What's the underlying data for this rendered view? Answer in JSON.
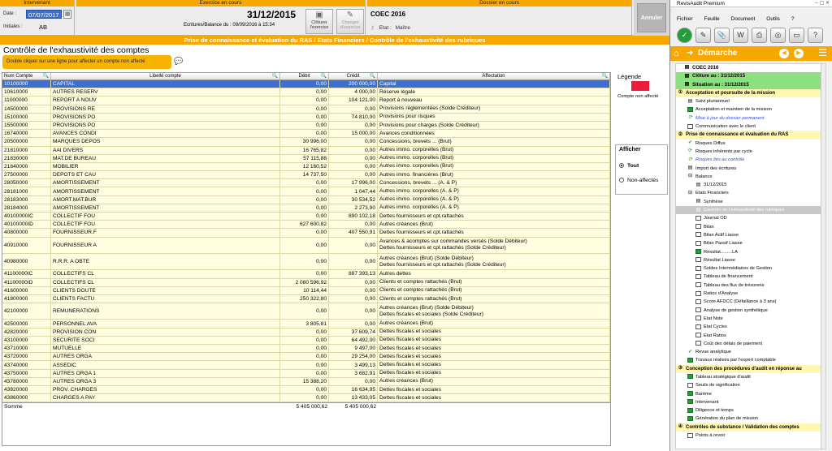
{
  "header": {
    "intervenant": {
      "title": "Intervenant",
      "date_label": "Date :",
      "date_value": "07/07/2017",
      "initials_label": "Initiales :",
      "initials_value": "AB"
    },
    "exercice": {
      "title": "Exercice en cours",
      "date": "31/12/2015",
      "ecritures": "Ecritures/Balance du :  09/09/2016 à 15:34",
      "cloturer": "Clôturer l'exercice",
      "changer": "Changer d'exercice"
    },
    "dossier": {
      "title": "Dossier en cours",
      "name": "COEC 2016",
      "etat_label": "Etat :",
      "etat_value": "Maître"
    },
    "annuler": "Annuler"
  },
  "title_bar": "Prise de connaissance et évaluation du RAS / Etats Financiers / Contrôle de l'exhaustivité des rubriques",
  "page_title": "Contrôle de l'exhaustivité des comptes",
  "hint": "Double cliquer sur une ligne pour affecter un compte non affecté",
  "table": {
    "headers": {
      "num": "Num Compte",
      "libelle": "Libellé compte",
      "debit": "Débit",
      "credit": "Crédit",
      "affectation": "Affectation"
    },
    "rows": [
      {
        "num": "10100000",
        "lib": "CAPITAL",
        "deb": "0,00",
        "cre": "200 000,00",
        "aff": [
          "Capital"
        ]
      },
      {
        "num": "10610000",
        "lib": "AUTRES RESERV",
        "deb": "0,00",
        "cre": "4 000,00",
        "aff": [
          "Réserve légale"
        ]
      },
      {
        "num": "11000000",
        "lib": "REPORT A NOUV",
        "deb": "0,00",
        "cre": "104 121,00",
        "aff": [
          "Report à nouveau"
        ]
      },
      {
        "num": "14500000",
        "lib": "PROVISIONS RE",
        "deb": "0,00",
        "cre": "0,00",
        "aff": [
          "Provisions réglementées  (Solde Créditeur)"
        ]
      },
      {
        "num": "15100000",
        "lib": "PROVISIONS PO",
        "deb": "0,00",
        "cre": "74 810,00",
        "aff": [
          "Provisions pour risques"
        ]
      },
      {
        "num": "15500000",
        "lib": "PROVISIONS PO",
        "deb": "0,00",
        "cre": "0,00",
        "aff": [
          "Provisions pour charges  (Solde Créditeur)"
        ]
      },
      {
        "num": "16740000",
        "lib": "AVANCES CONDI",
        "deb": "0,00",
        "cre": "15 000,00",
        "aff": [
          "Avances conditionnées"
        ]
      },
      {
        "num": "20500000",
        "lib": "MARQUES DEPOS",
        "deb": "30 996,00",
        "cre": "0,00",
        "aff": [
          "Concessions, brevets ...  (Brut)"
        ]
      },
      {
        "num": "21810000",
        "lib": "AAI DIVERS",
        "deb": "16 765,82",
        "cre": "0,00",
        "aff": [
          "Autres immo. corporelles  (Brut)"
        ]
      },
      {
        "num": "21830000",
        "lib": "MAT.DE BUREAU",
        "deb": "57 115,88",
        "cre": "0,00",
        "aff": [
          "Autres immo. corporelles  (Brut)"
        ]
      },
      {
        "num": "21840000",
        "lib": "MOBILIER",
        "deb": "12 160,52",
        "cre": "0,00",
        "aff": [
          "Autres immo. corporelles  (Brut)"
        ]
      },
      {
        "num": "27500000",
        "lib": "DEPOTS ET CAU",
        "deb": "14 737,50",
        "cre": "0,00",
        "aff": [
          "Autres immo. financières  (Brut)"
        ]
      },
      {
        "num": "28050000",
        "lib": "AMORTISSEMENT",
        "deb": "0,00",
        "cre": "17 996,00",
        "aff": [
          "Concessions, brevets ...  (A. & P)"
        ]
      },
      {
        "num": "28181000",
        "lib": "AMORTISSEMENT",
        "deb": "0,00",
        "cre": "1 047,44",
        "aff": [
          "Autres immo. corporelles  (A. & P)"
        ]
      },
      {
        "num": "28183000",
        "lib": "AMORT.MAT.BUR",
        "deb": "0,00",
        "cre": "30 534,52",
        "aff": [
          "Autres immo. corporelles  (A. & P)"
        ]
      },
      {
        "num": "28184000",
        "lib": "AMORTISSEMENT",
        "deb": "0,00",
        "cre": "2 273,90",
        "aff": [
          "Autres immo. corporelles  (A. & P)"
        ]
      },
      {
        "num": "40100000IC",
        "lib": "COLLECTIF FOU",
        "deb": "0,00",
        "cre": "890 102,18",
        "aff": [
          "Dettes fournisseurs et cpt.rattachés"
        ]
      },
      {
        "num": "40100000ID",
        "lib": "COLLECTIF FOU",
        "deb": "627 600,82",
        "cre": "0,00",
        "aff": [
          "Autres créances  (Brut)"
        ]
      },
      {
        "num": "40800000",
        "lib": "FOURNISSEUR.F",
        "deb": "0,00",
        "cre": "407 550,91",
        "aff": [
          "Dettes fournisseurs et cpt.rattachés"
        ]
      },
      {
        "num": "40910000",
        "lib": "FOURNISSEUR A",
        "deb": "0,00",
        "cre": "0,00",
        "aff": [
          "Avances & acomptes sur commandes versés  (Solde Débiteur)",
          "Dettes fournisseurs et cpt.rattachés  (Solde Créditeur)"
        ]
      },
      {
        "num": "40980000",
        "lib": "R.R.R. A OBTE",
        "deb": "0,00",
        "cre": "0,00",
        "aff": [
          "Autres créances (Brut)  (Solde Débiteur)",
          "Dettes fournisseurs et cpt.rattachés  (Solde Créditeur)"
        ]
      },
      {
        "num": "41100000IC",
        "lib": "COLLECTIFS CL",
        "deb": "0,00",
        "cre": "887 393,13",
        "aff": [
          "Autres dettes"
        ]
      },
      {
        "num": "41100000ID",
        "lib": "COLLECTIFS CL",
        "deb": "2 080 596,92",
        "cre": "0,00",
        "aff": [
          "Clients et comptes rattachés  (Brut)"
        ]
      },
      {
        "num": "41600000",
        "lib": "CLIENTS DOUTE",
        "deb": "10 114,44",
        "cre": "0,00",
        "aff": [
          "Clients et comptes rattachés  (Brut)"
        ]
      },
      {
        "num": "41800000",
        "lib": "CLIENTS FACTU",
        "deb": "250 322,80",
        "cre": "0,00",
        "aff": [
          "Clients et comptes rattachés  (Brut)"
        ]
      },
      {
        "num": "42100000",
        "lib": "REMUNERATIONS",
        "deb": "0,00",
        "cre": "0,00",
        "aff": [
          "Autres créances (Brut)  (Solde Débiteur)",
          "Dettes fiscales et sociales  (Solde Créditeur)"
        ]
      },
      {
        "num": "42500000",
        "lib": "PERSONNEL AVA",
        "deb": "3 805,81",
        "cre": "0,00",
        "aff": [
          "Autres créances  (Brut)"
        ]
      },
      {
        "num": "42820000",
        "lib": "PROVISION CON",
        "deb": "0,00",
        "cre": "37 609,74",
        "aff": [
          "Dettes fiscales et sociales"
        ]
      },
      {
        "num": "43100000",
        "lib": "SECURITE SOCI",
        "deb": "0,00",
        "cre": "64 492,00",
        "aff": [
          "Dettes fiscales et sociales"
        ]
      },
      {
        "num": "43710000",
        "lib": "MUTUELLE",
        "deb": "0,00",
        "cre": "9 497,00",
        "aff": [
          "Dettes fiscales et sociales"
        ]
      },
      {
        "num": "43720000",
        "lib": "AUTRES ORGA",
        "deb": "0,00",
        "cre": "29 254,00",
        "aff": [
          "Dettes fiscales et sociales"
        ]
      },
      {
        "num": "43740000",
        "lib": "ASSEDIC",
        "deb": "0,00",
        "cre": "3 499,13",
        "aff": [
          "Dettes fiscales et sociales"
        ]
      },
      {
        "num": "43750000",
        "lib": "AUTRES ORGA 1",
        "deb": "0,00",
        "cre": "3 682,91",
        "aff": [
          "Dettes fiscales et sociales"
        ]
      },
      {
        "num": "43780000",
        "lib": "AUTRES ORGA 3",
        "deb": "15 388,20",
        "cre": "0,00",
        "aff": [
          "Autres créances  (Brut)"
        ]
      },
      {
        "num": "43820000",
        "lib": "PROV. CHARGES",
        "deb": "0,00",
        "cre": "16 634,95",
        "aff": [
          "Dettes fiscales et sociales"
        ]
      },
      {
        "num": "43860000",
        "lib": "CHARGES A PAY",
        "deb": "0,00",
        "cre": "13 433,05",
        "aff": [
          "Dettes fiscales et sociales"
        ]
      }
    ],
    "total": {
      "label": "Somme",
      "deb": "5 405 000,62",
      "cre": "5 405 000,62"
    }
  },
  "legend": {
    "title": "Légende",
    "swatch_color": "#ea1b3d",
    "text": "Compte non affecté"
  },
  "filter": {
    "title": "Afficher",
    "opt_all": "Tout",
    "opt_unassigned": "Non-affectés"
  },
  "panel": {
    "app_title": "RevisAudit Premium",
    "menu": [
      "Fichier",
      "Feuille",
      "Document",
      "Outils",
      "?"
    ],
    "nav_title": "Démarche",
    "tree": [
      {
        "t": "COEC 2016",
        "k": "bold",
        "ind": 10,
        "ic": "doc"
      },
      {
        "t": "Clôture au   : 31/12/2015",
        "k": "ok",
        "ind": 10,
        "ic": "doc"
      },
      {
        "t": "Situation au  : 31/12/2015",
        "k": "ok",
        "ind": 10,
        "ic": "doc"
      },
      {
        "t": "Acceptation et poursuite de la mission",
        "k": "sec",
        "ind": 2,
        "ic": "num1"
      },
      {
        "t": "Suivi pluriannuel",
        "k": "",
        "ind": 14,
        "ic": "doc"
      },
      {
        "t": "Acceptation et maintien de la mission",
        "k": "",
        "ind": 14,
        "ic": "fill"
      },
      {
        "t": "Mise à jour du dossier permanent",
        "k": "link",
        "ind": 14,
        "ic": "spin"
      },
      {
        "t": "Communication avec le client",
        "k": "",
        "ind": 14,
        "ic": "box"
      },
      {
        "t": "Prise de connaissance et évaluation du RAS",
        "k": "sec",
        "ind": 2,
        "ic": "num2"
      },
      {
        "t": "Risques Diffus",
        "k": "",
        "ind": 14,
        "ic": "ok"
      },
      {
        "t": "Risques inhérents par cycle",
        "k": "",
        "ind": 14,
        "ic": "spin"
      },
      {
        "t": "Risques liés au contrôle",
        "k": "link",
        "ind": 14,
        "ic": "spin"
      },
      {
        "t": "Import des écritures",
        "k": "",
        "ind": 14,
        "ic": "doc"
      },
      {
        "t": "Balance",
        "k": "",
        "ind": 14,
        "ic": "minus"
      },
      {
        "t": "31/12/2015",
        "k": "",
        "ind": 24,
        "ic": "doc"
      },
      {
        "t": "Etats Financiers",
        "k": "",
        "ind": 14,
        "ic": "minus"
      },
      {
        "t": "Synthèse",
        "k": "",
        "ind": 24,
        "ic": "doc"
      },
      {
        "t": "Contrôle de l'exhaustivité des rubriques",
        "k": "cur",
        "ind": 24,
        "ic": "doc"
      },
      {
        "t": "Journal OD",
        "k": "",
        "ind": 24,
        "ic": "box"
      },
      {
        "t": "Bilan",
        "k": "",
        "ind": 24,
        "ic": "box"
      },
      {
        "t": "Bilan Actif Liasse",
        "k": "",
        "ind": 24,
        "ic": "box"
      },
      {
        "t": "Bilan Passif Liasse",
        "k": "",
        "ind": 24,
        "ic": "box"
      },
      {
        "t": "Résultat.........LA",
        "k": "",
        "ind": 24,
        "ic": "fill"
      },
      {
        "t": "Résultat Liasse",
        "k": "",
        "ind": 24,
        "ic": "box"
      },
      {
        "t": "Soldes Intermédiaires de Gestion",
        "k": "",
        "ind": 24,
        "ic": "box"
      },
      {
        "t": "Tableau de financement",
        "k": "",
        "ind": 24,
        "ic": "box"
      },
      {
        "t": "Tableau des flux de trésorerie",
        "k": "",
        "ind": 24,
        "ic": "box"
      },
      {
        "t": "Ratios d'Analyse",
        "k": "",
        "ind": 24,
        "ic": "box"
      },
      {
        "t": "Score AFDCC (Défaillance à 3 ans)",
        "k": "",
        "ind": 24,
        "ic": "box"
      },
      {
        "t": "Analyse de gestion synthétique",
        "k": "",
        "ind": 24,
        "ic": "box"
      },
      {
        "t": "Etat Note",
        "k": "",
        "ind": 24,
        "ic": "box"
      },
      {
        "t": "Etat Cycles",
        "k": "",
        "ind": 24,
        "ic": "box"
      },
      {
        "t": "Etat Ratios",
        "k": "",
        "ind": 24,
        "ic": "box"
      },
      {
        "t": "Coût des délais de paiement",
        "k": "",
        "ind": 24,
        "ic": "box"
      },
      {
        "t": "Revue analytique",
        "k": "",
        "ind": 14,
        "ic": "ok"
      },
      {
        "t": "Travaux réalisés par l'expert comptable",
        "k": "",
        "ind": 14,
        "ic": "fill"
      },
      {
        "t": "Conception des procédures d'audit en réponse au",
        "k": "sec",
        "ind": 2,
        "ic": "num3"
      },
      {
        "t": "Tableau stratégique d'audit",
        "k": "",
        "ind": 14,
        "ic": "fill"
      },
      {
        "t": "Seuils de signification",
        "k": "",
        "ind": 14,
        "ic": "box"
      },
      {
        "t": "Barème",
        "k": "",
        "ind": 14,
        "ic": "fill"
      },
      {
        "t": "Intervenant",
        "k": "",
        "ind": 14,
        "ic": "fill"
      },
      {
        "t": "Diligence et temps",
        "k": "",
        "ind": 14,
        "ic": "fill"
      },
      {
        "t": "Génération du plan de mission",
        "k": "",
        "ind": 14,
        "ic": "fill"
      },
      {
        "t": "Contrôles de substance / Validation des comptes",
        "k": "sec",
        "ind": 2,
        "ic": "num4"
      },
      {
        "t": "Points à revoir",
        "k": "",
        "ind": 14,
        "ic": "box"
      }
    ]
  }
}
